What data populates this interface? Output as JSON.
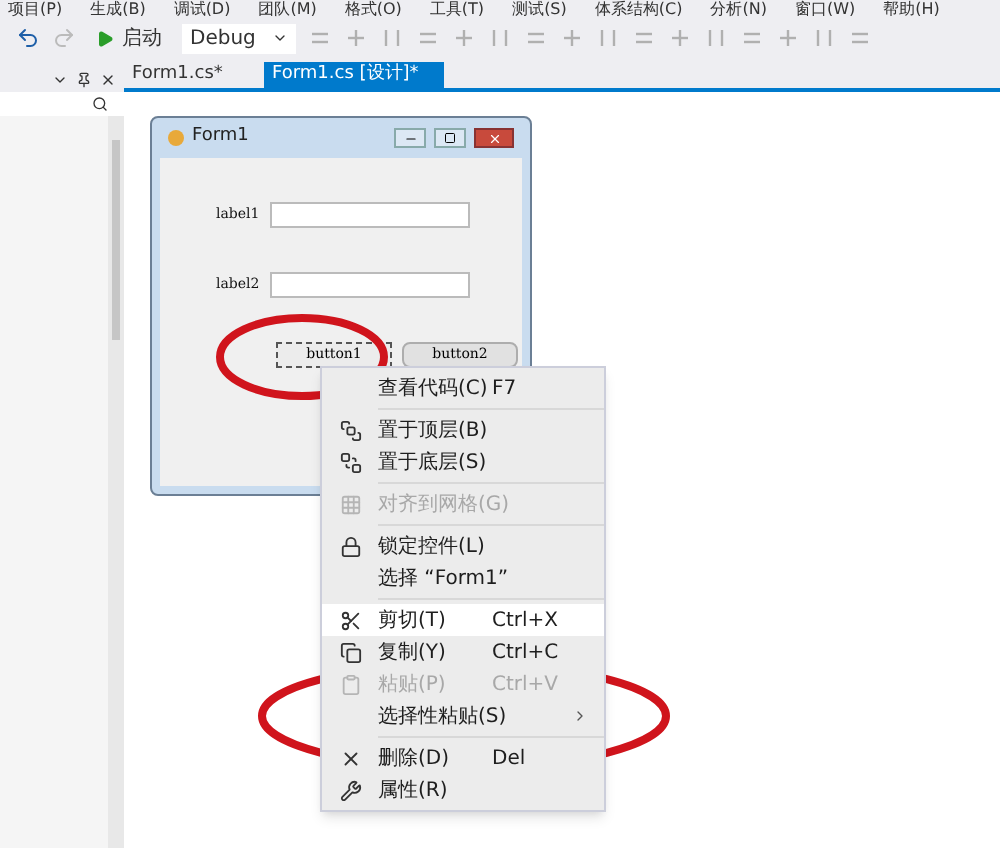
{
  "menu_bar": [
    "项目(P)",
    "生成(B)",
    "调试(D)",
    "团队(M)",
    "格式(O)",
    "工具(T)",
    "测试(S)",
    "体系结构(C)",
    "分析(N)",
    "窗口(W)",
    "帮助(H)"
  ],
  "toolbar": {
    "start_label": "启动",
    "configuration": "Debug"
  },
  "tabs": [
    {
      "label": "Form1.cs*",
      "selected": false
    },
    {
      "label": "Form1.cs [设计]*",
      "selected": true
    }
  ],
  "form": {
    "title": "Form1",
    "labels": [
      "label1",
      "label2"
    ],
    "buttons": [
      {
        "label": "button1",
        "selected": true
      },
      {
        "label": "button2",
        "selected": false
      }
    ]
  },
  "context_menu": [
    {
      "kind": "item",
      "label": "查看代码(C)",
      "shortcut": "F7",
      "disabled": false,
      "highlighted": false,
      "submenu": false
    },
    {
      "kind": "separator"
    },
    {
      "kind": "item",
      "label": "置于顶层(B)",
      "disabled": false,
      "highlighted": false,
      "submenu": false
    },
    {
      "kind": "item",
      "label": "置于底层(S)",
      "disabled": false,
      "highlighted": false,
      "submenu": false
    },
    {
      "kind": "separator"
    },
    {
      "kind": "item",
      "label": "对齐到网格(G)",
      "disabled": true,
      "highlighted": false,
      "submenu": false
    },
    {
      "kind": "separator"
    },
    {
      "kind": "item",
      "label": "锁定控件(L)",
      "disabled": false,
      "highlighted": false,
      "submenu": false
    },
    {
      "kind": "item",
      "label": "选择 “Form1”",
      "disabled": false,
      "highlighted": false,
      "submenu": false
    },
    {
      "kind": "separator"
    },
    {
      "kind": "item",
      "label": "剪切(T)",
      "shortcut": "Ctrl+X",
      "disabled": false,
      "highlighted": true,
      "submenu": false
    },
    {
      "kind": "item",
      "label": "复制(Y)",
      "shortcut": "Ctrl+C",
      "disabled": false,
      "highlighted": false,
      "submenu": false
    },
    {
      "kind": "item",
      "label": "粘贴(P)",
      "shortcut": "Ctrl+V",
      "disabled": true,
      "highlighted": false,
      "submenu": false
    },
    {
      "kind": "item",
      "label": "选择性粘贴(S)",
      "disabled": false,
      "highlighted": false,
      "submenu": true
    },
    {
      "kind": "separator"
    },
    {
      "kind": "item",
      "label": "删除(D)",
      "shortcut": "Del",
      "disabled": false,
      "highlighted": false,
      "submenu": false
    },
    {
      "kind": "item",
      "label": "属性(R)",
      "disabled": false,
      "highlighted": false,
      "submenu": false
    }
  ]
}
